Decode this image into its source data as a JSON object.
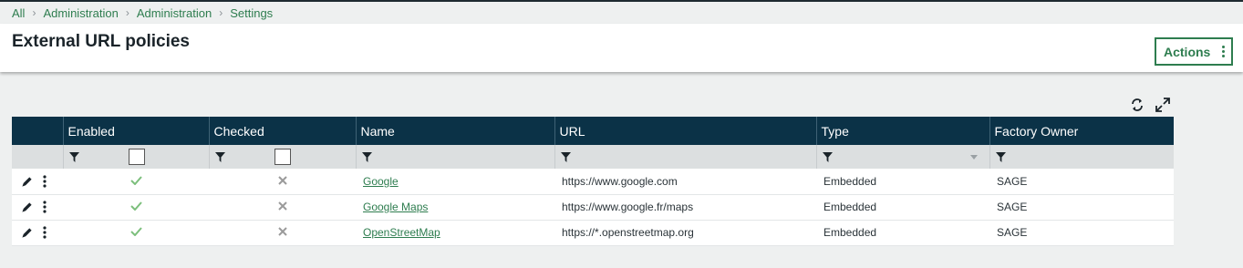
{
  "breadcrumb": [
    "All",
    "Administration",
    "Administration",
    "Settings"
  ],
  "page": {
    "title": "External URL policies",
    "actions_label": "Actions"
  },
  "colors": {
    "accent": "#2e7d4f",
    "header_bg": "#0b3247",
    "check": "#7cbf7c",
    "cross": "#9a9a9a"
  },
  "grid": {
    "columns": [
      "",
      "Enabled",
      "Checked",
      "Name",
      "URL",
      "Type",
      "Factory Owner"
    ],
    "rows": [
      {
        "enabled": true,
        "checked": false,
        "name": "Google",
        "url": "https://www.google.com",
        "type": "Embedded",
        "owner": "SAGE"
      },
      {
        "enabled": true,
        "checked": false,
        "name": "Google Maps",
        "url": "https://www.google.fr/maps",
        "type": "Embedded",
        "owner": "SAGE"
      },
      {
        "enabled": true,
        "checked": false,
        "name": "OpenStreetMap",
        "url": "https://*.openstreetmap.org",
        "type": "Embedded",
        "owner": "SAGE"
      }
    ]
  }
}
